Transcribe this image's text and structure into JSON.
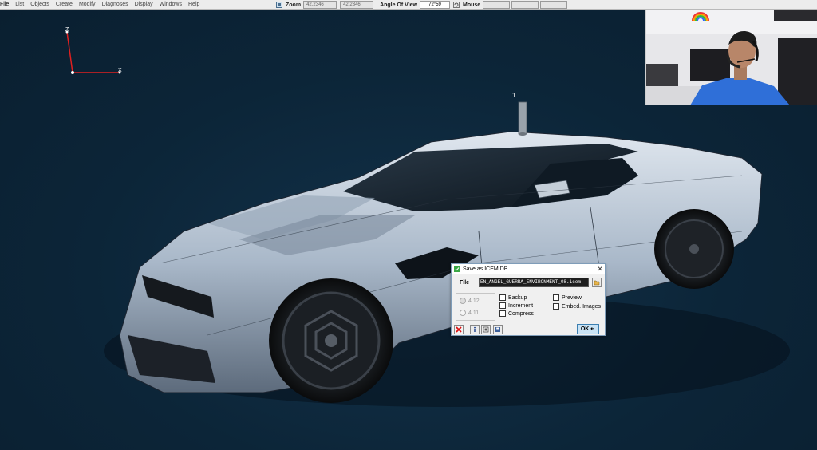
{
  "menu": {
    "items": [
      "File",
      "List",
      "Objects",
      "Create",
      "Modify",
      "Diagnoses",
      "Display",
      "Windows",
      "Help"
    ]
  },
  "toolbar": {
    "zoom_label": "Zoom",
    "zoom_value_1": "42.2346",
    "zoom_value_2": "42.2346",
    "angle_label": "Angle Of View",
    "angle_value": "72°59",
    "mouse_label": "Mouse"
  },
  "viewport": {
    "axis_z": "Z",
    "axis_x": "X",
    "marker_label": "1"
  },
  "dialog": {
    "title": "Save as ICEM DB",
    "file_label": "File",
    "file_value": "EN_ANGEL_GUERRA_ENVIRONMENT_08.icem",
    "version_1": "4.12",
    "version_2": "4.11",
    "backup_label": "Backup",
    "increment_label": "Increment",
    "compress_label": "Compress",
    "preview_label": "Preview",
    "embed_images_label": "Embed. Images",
    "ok_label": "OK"
  },
  "colors": {
    "viewport_bg": "#0f2a3d",
    "axis_red": "#e02020",
    "ok_button": "#c9e3f5"
  }
}
